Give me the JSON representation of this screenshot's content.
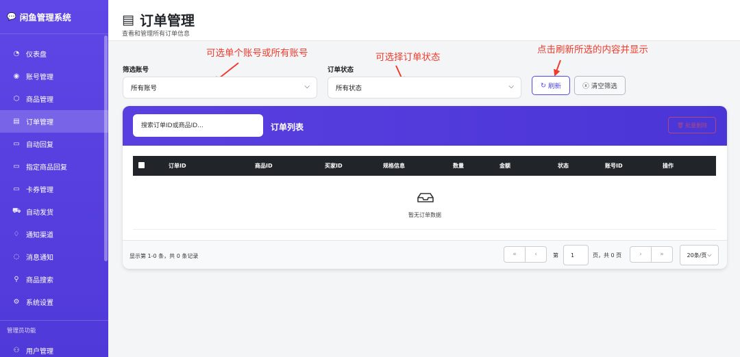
{
  "app": {
    "title": "闲鱼管理系统",
    "logo_icon": "chat-bubble-icon"
  },
  "sidebar": {
    "items": [
      {
        "label": "仪表盘",
        "icon": "dashboard-icon",
        "glyph": "◔"
      },
      {
        "label": "账号管理",
        "icon": "user-circle-icon",
        "glyph": "◉"
      },
      {
        "label": "商品管理",
        "icon": "box-icon",
        "glyph": "⬡"
      },
      {
        "label": "订单管理",
        "icon": "receipt-icon",
        "glyph": "▤",
        "active": true
      },
      {
        "label": "自动回复",
        "icon": "message-square-icon",
        "glyph": "▭"
      },
      {
        "label": "指定商品回复",
        "icon": "message-text-icon",
        "glyph": "▭"
      },
      {
        "label": "卡券管理",
        "icon": "credit-card-icon",
        "glyph": "▭"
      },
      {
        "label": "自动发货",
        "icon": "truck-icon",
        "glyph": "⛟"
      },
      {
        "label": "通知渠道",
        "icon": "bell-icon",
        "glyph": "♢"
      },
      {
        "label": "消息通知",
        "icon": "chat-dots-icon",
        "glyph": "◌"
      },
      {
        "label": "商品搜索",
        "icon": "search-icon",
        "glyph": "⚲"
      },
      {
        "label": "系统设置",
        "icon": "gear-icon",
        "glyph": "⚙"
      }
    ],
    "admin_section": "管理员功能",
    "admin_items": [
      {
        "label": "用户管理",
        "icon": "users-icon",
        "glyph": "⚇"
      }
    ]
  },
  "header": {
    "title": "订单管理",
    "subtitle": "查看和管理所有订单信息"
  },
  "annotations": {
    "account": "可选单个账号或所有账号",
    "status": "可选择订单状态",
    "refresh": "点击刷新所选的内容并显示"
  },
  "filters": {
    "account_label": "筛选账号",
    "account_value": "所有账号",
    "status_label": "订单状态",
    "status_value": "所有状态",
    "refresh_label": "刷新",
    "clear_label": "清空筛选"
  },
  "orders": {
    "search_placeholder": "搜索订单ID或商品ID...",
    "list_title": "订单列表",
    "batch_delete": "批量删除",
    "columns": [
      "订单ID",
      "商品ID",
      "买家ID",
      "规格信息",
      "数量",
      "金额",
      "状态",
      "账号ID",
      "操作"
    ],
    "empty_text": "暂无订单数据"
  },
  "pagination": {
    "info": "显示第 1-0 条，共 0 条记录",
    "page_prefix": "第",
    "page_value": "1",
    "page_suffix": "页，共 0 页",
    "page_size": "20条/页"
  },
  "colors": {
    "accent": "#4f46e5",
    "annotation": "#ef3b2c",
    "table_header": "#212529"
  }
}
